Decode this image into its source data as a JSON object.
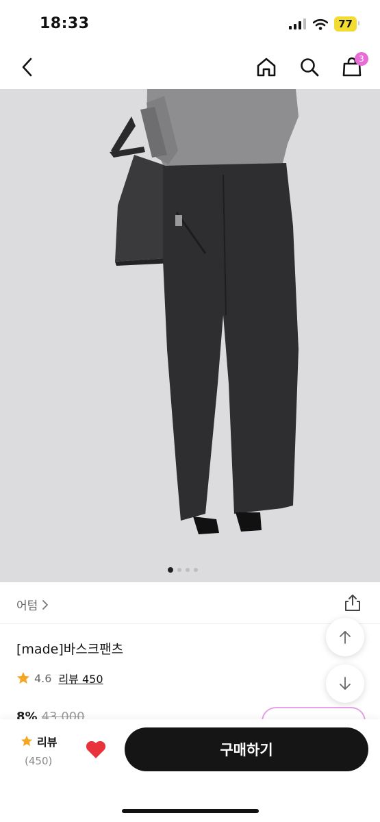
{
  "status": {
    "time": "18:33",
    "battery": "77"
  },
  "nav": {
    "cart_count": "3"
  },
  "product": {
    "brand": "어텀",
    "name": "[made]바스크팬츠",
    "rating": "4.6",
    "review_link": "리뷰 450",
    "discount": "8%",
    "original_price": "43,000"
  },
  "bottom": {
    "review_label": "리뷰",
    "review_count": "(450)",
    "buy_label": "구매하기"
  },
  "colors": {
    "accent_pink": "#e86cd6",
    "star": "#f5a623",
    "heart": "#e8333c",
    "buy_button": "#151515"
  }
}
